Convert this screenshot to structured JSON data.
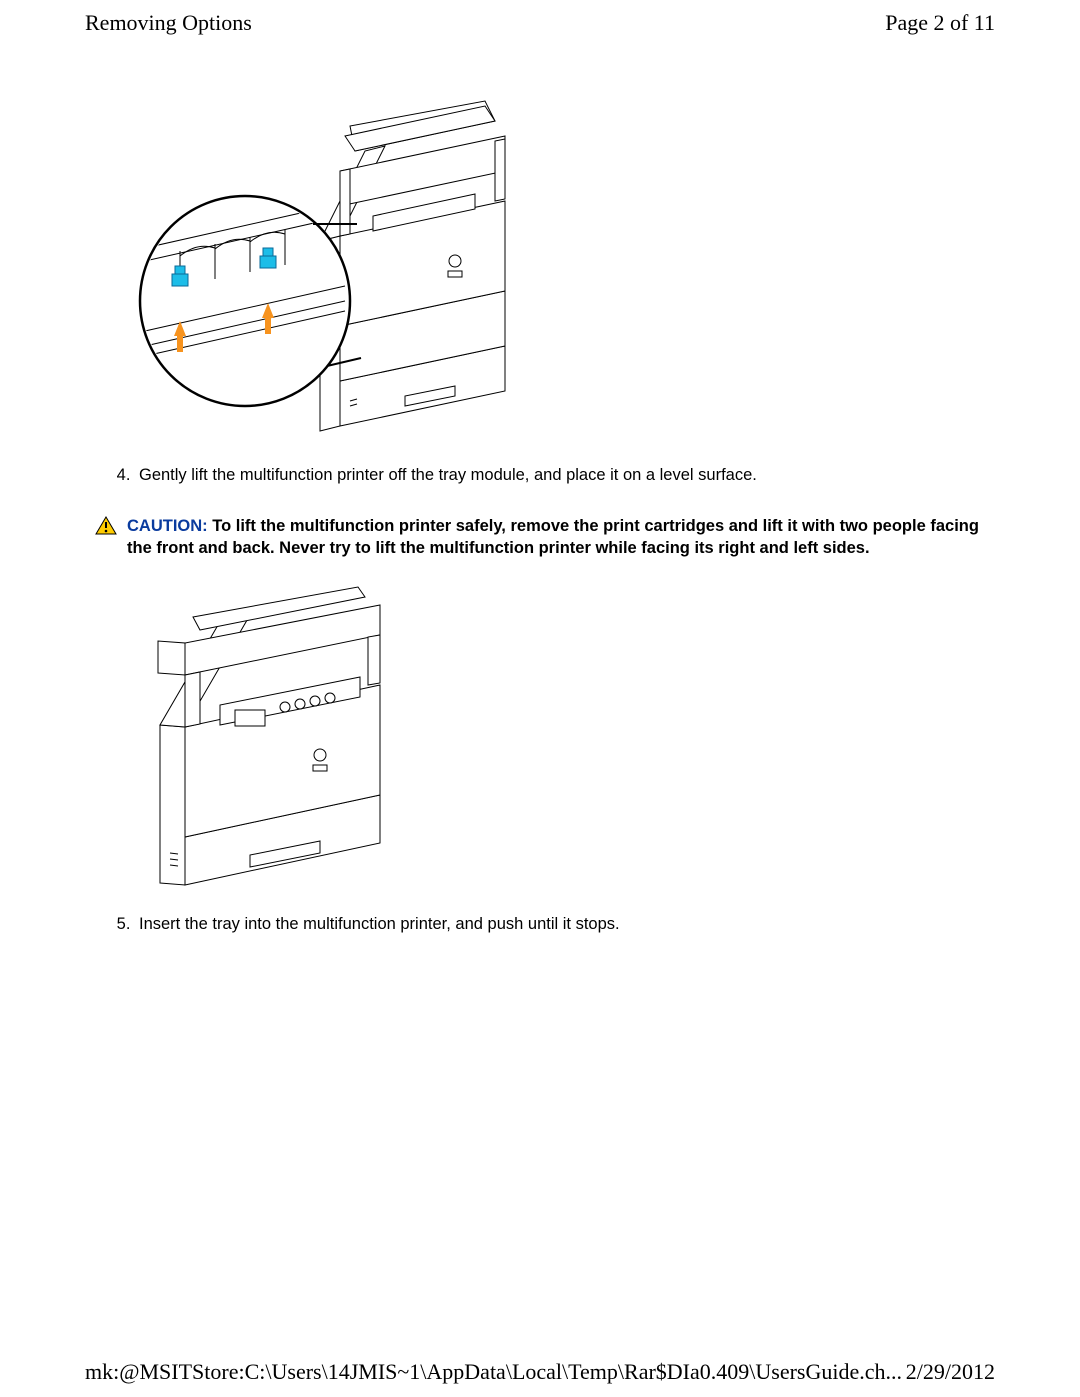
{
  "header": {
    "title": "Removing Options",
    "page_label": "Page 2 of 11"
  },
  "steps": {
    "start": 4,
    "items": [
      "Gently lift the multifunction printer off the tray module, and place it on a level surface.",
      "Insert the tray into the multifunction printer, and push until it stops."
    ]
  },
  "caution": {
    "label": "CAUTION:",
    "text": "To lift the multifunction printer safely, remove the print cartridges and lift it with two people facing the front and back. Never try to lift the multifunction printer while facing its right and left sides."
  },
  "footer": {
    "path": "mk:@MSITStore:C:\\Users\\14JMIS~1\\AppData\\Local\\Temp\\Rar$DIa0.409\\UsersGuide.ch...",
    "date": "2/29/2012"
  }
}
